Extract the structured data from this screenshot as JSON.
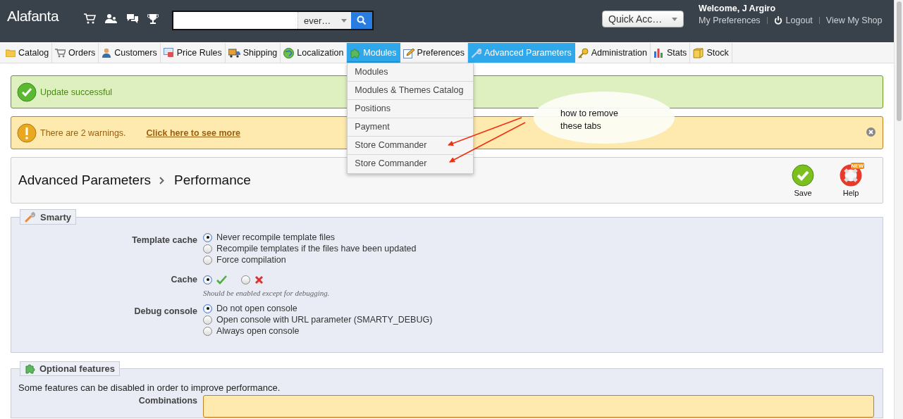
{
  "header": {
    "logo": "Alafanta",
    "search": {
      "scope": "ever…"
    },
    "quick_access": "Quick Acc…",
    "welcome": "Welcome, J Argiro",
    "links": [
      "My Preferences",
      "Logout",
      "View My Shop"
    ]
  },
  "tabs": [
    {
      "label": "Catalog",
      "selected": false,
      "expanded": false
    },
    {
      "label": "Orders",
      "selected": false,
      "expanded": false
    },
    {
      "label": "Customers",
      "selected": false,
      "expanded": false
    },
    {
      "label": "Price Rules",
      "selected": false,
      "expanded": false
    },
    {
      "label": "Shipping",
      "selected": false,
      "expanded": false
    },
    {
      "label": "Localization",
      "selected": false,
      "expanded": false
    },
    {
      "label": "Modules",
      "selected": true,
      "expanded": true
    },
    {
      "label": "Preferences",
      "selected": false,
      "expanded": false
    },
    {
      "label": "Advanced Parameters",
      "selected": true,
      "expanded": false
    },
    {
      "label": "Administration",
      "selected": false,
      "expanded": false
    },
    {
      "label": "Stats",
      "selected": false,
      "expanded": false
    },
    {
      "label": "Stock",
      "selected": false,
      "expanded": false
    }
  ],
  "tab_menu": [
    "Modules",
    "Modules & Themes Catalog",
    "Positions",
    "Payment",
    "Store Commander",
    "Store Commander"
  ],
  "alerts": [
    {
      "kind": "success",
      "text": "Update successful"
    },
    {
      "kind": "warning",
      "text": "There are 2 warnings.",
      "link": "Click here to see more"
    }
  ],
  "toolbar": {
    "breadcrumb": [
      "Advanced Parameters",
      "Performance"
    ],
    "buttons": [
      {
        "kind": "save",
        "label": "Save"
      },
      {
        "kind": "help",
        "label": "Help",
        "badge": "NEW"
      }
    ]
  },
  "smarty": {
    "legend": "Smarty",
    "fields": [
      {
        "label": "Template cache",
        "kind": "list",
        "options": [
          {
            "label": "Never recompile template files",
            "selected": true
          },
          {
            "label": "Recompile templates if the files have been updated",
            "selected": false
          },
          {
            "label": "Force compilation",
            "selected": false
          }
        ]
      },
      {
        "label": "Cache",
        "kind": "yesno",
        "options": [
          {
            "kind": "yes",
            "selected": true
          },
          {
            "kind": "no",
            "selected": false
          }
        ],
        "hint": "Should be enabled except for debugging."
      },
      {
        "label": "Debug console",
        "kind": "list",
        "options": [
          {
            "label": "Do not open console",
            "selected": true
          },
          {
            "label": "Open console with URL parameter (SMARTY_DEBUG)",
            "selected": false
          },
          {
            "label": "Always open console",
            "selected": false
          }
        ]
      }
    ]
  },
  "optional_features": {
    "legend": "Optional features",
    "intro": "Some features can be disabled in order to improve performance.",
    "field_label": "Combinations"
  },
  "annotation": {
    "text": "how to remove these tabs"
  }
}
